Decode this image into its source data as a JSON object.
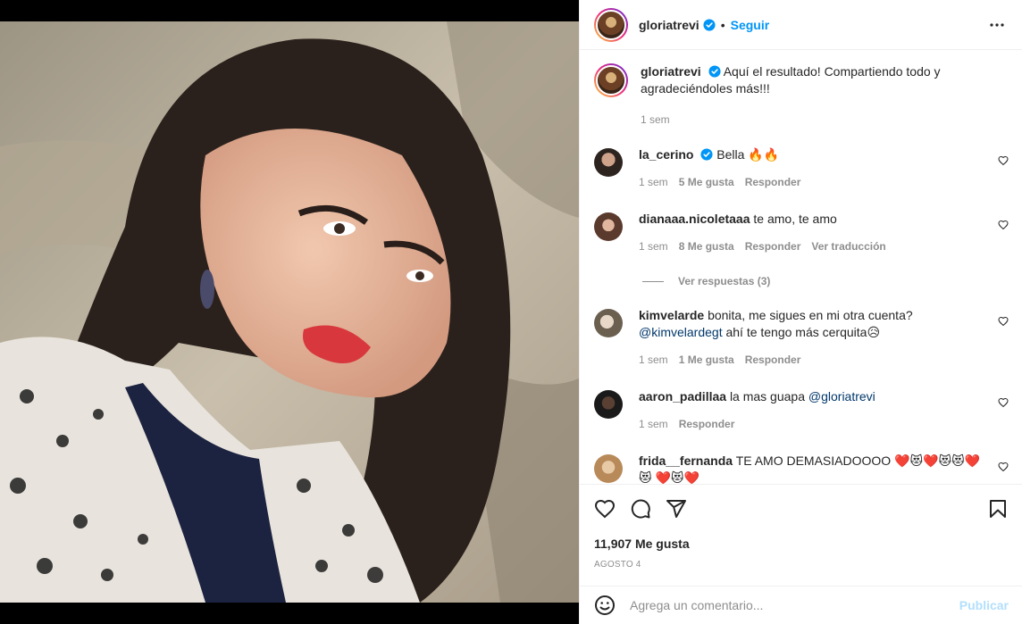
{
  "header": {
    "username": "gloriatrevi",
    "separator": "•",
    "follow_label": "Seguir"
  },
  "caption": {
    "username": "gloriatrevi",
    "text": "Aquí el resultado! Compartiendo todo y agradeciéndoles más!!!",
    "time": "1 sem"
  },
  "comments": [
    {
      "username": "la_cerino",
      "text": "Bella 🔥🔥",
      "time": "1 sem",
      "likes": "5 Me gusta",
      "reply": "Responder",
      "verified": true
    },
    {
      "username": "dianaaa.nicoletaaa",
      "text": "te amo, te amo",
      "time": "1 sem",
      "likes": "8 Me gusta",
      "reply": "Responder",
      "translate": "Ver traducción"
    },
    {
      "username": "kimvelarde",
      "text": "bonita, me sigues en mi otra cuenta?",
      "mention": "@kimvelardegt",
      "text2": "ahí te tengo más cerquita😥",
      "time": "1 sem",
      "likes": "1 Me gusta",
      "reply": "Responder"
    },
    {
      "username": "aaron_padillaa",
      "text": "la mas guapa",
      "mention": "@gloriatrevi",
      "time": "1 sem",
      "reply": "Responder"
    },
    {
      "username": "frida__fernanda",
      "text": "TE AMO DEMASIADOOOO ❤️😻❤️😻😻❤️😻",
      "text2": "❤️😻❤️"
    }
  ],
  "view_replies": "Ver respuestas (3)",
  "likes_count": "11,907 Me gusta",
  "post_date": "Agosto 4",
  "add_comment": {
    "placeholder": "Agrega un comentario...",
    "publish_label": "Publicar"
  },
  "colors": {
    "accent": "#0095f6",
    "publish_disabled": "#b2dffc",
    "muted": "#8e8e8e",
    "mention": "#00376b"
  },
  "icons": [
    "verified-badge-icon",
    "more-options-icon",
    "heart-icon",
    "comment-icon",
    "share-icon",
    "bookmark-icon",
    "emoji-icon"
  ]
}
